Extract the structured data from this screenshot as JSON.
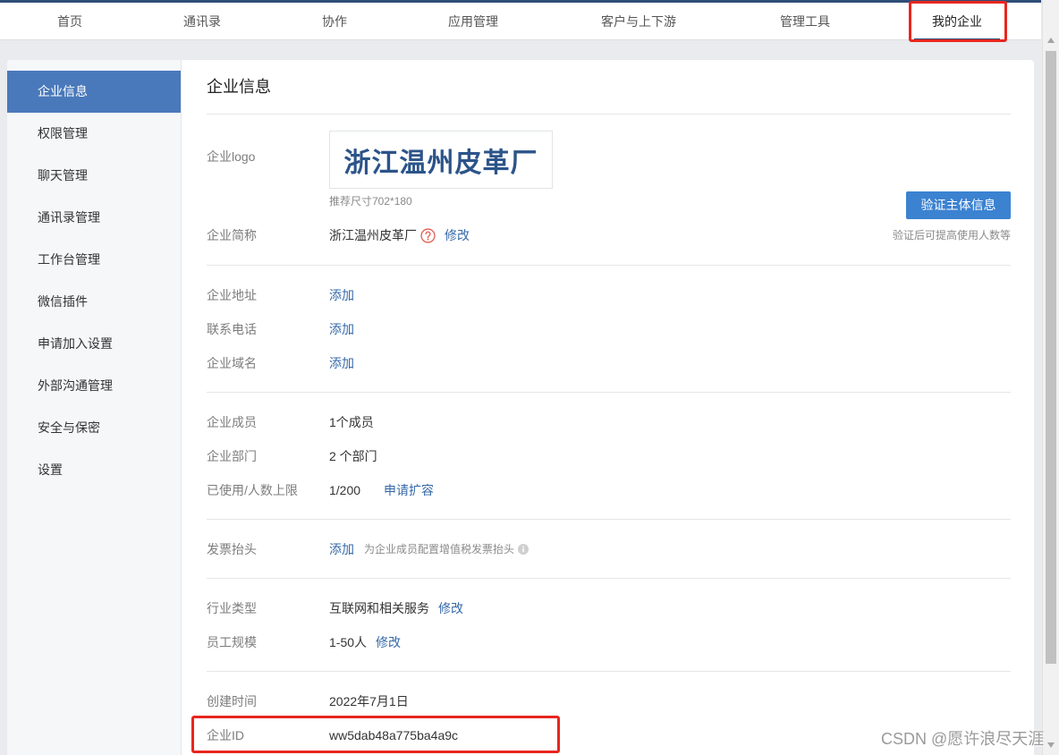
{
  "nav": {
    "items": [
      {
        "label": "首页"
      },
      {
        "label": "通讯录"
      },
      {
        "label": "协作"
      },
      {
        "label": "应用管理"
      },
      {
        "label": "客户与上下游"
      },
      {
        "label": "管理工具"
      },
      {
        "label": "我的企业",
        "active": true
      }
    ]
  },
  "sidebar": {
    "items": [
      {
        "label": "企业信息",
        "active": true
      },
      {
        "label": "权限管理"
      },
      {
        "label": "聊天管理"
      },
      {
        "label": "通讯录管理"
      },
      {
        "label": "工作台管理"
      },
      {
        "label": "微信插件"
      },
      {
        "label": "申请加入设置"
      },
      {
        "label": "外部沟通管理"
      },
      {
        "label": "安全与保密"
      },
      {
        "label": "设置"
      }
    ]
  },
  "main": {
    "title": "企业信息",
    "logo": {
      "label": "企业logo",
      "image_text": "浙江温州皮革厂",
      "size_hint": "推荐尺寸702*180"
    },
    "verify": {
      "button_label": "验证主体信息",
      "hint": "验证后可提高使用人数等"
    },
    "short_name": {
      "label": "企业简称",
      "value": "浙江温州皮革厂",
      "help_icon": "question-circle-icon",
      "edit_label": "修改"
    },
    "contact": {
      "address": {
        "label": "企业地址",
        "action_label": "添加"
      },
      "phone": {
        "label": "联系电话",
        "action_label": "添加"
      },
      "domain": {
        "label": "企业域名",
        "action_label": "添加"
      }
    },
    "scale": {
      "members": {
        "label": "企业成员",
        "value": "1个成员"
      },
      "departments": {
        "label": "企业部门",
        "value": "2 个部门"
      },
      "capacity": {
        "label": "已使用/人数上限",
        "value": "1/200",
        "action_label": "申请扩容"
      }
    },
    "invoice": {
      "label": "发票抬头",
      "action_label": "添加",
      "note": "为企业成员配置增值税发票抬头",
      "info_icon": "info-icon"
    },
    "industry": {
      "type": {
        "label": "行业类型",
        "value": "互联网和相关服务",
        "edit_label": "修改"
      },
      "size": {
        "label": "员工规模",
        "value": "1-50人",
        "edit_label": "修改"
      }
    },
    "meta": {
      "created": {
        "label": "创建时间",
        "value": "2022年7月1日"
      },
      "corp_id": {
        "label": "企业ID",
        "value": "ww5dab48a775ba4a9c"
      }
    }
  },
  "watermark": "CSDN @愿许浪尽天涯",
  "colors": {
    "nav_accent": "#2f4e78",
    "sidebar_active": "#4a79bb",
    "link": "#3569a8",
    "primary_button": "#3b82d1",
    "annotation_red": "#e8261e",
    "logo_text": "#2c5489"
  }
}
